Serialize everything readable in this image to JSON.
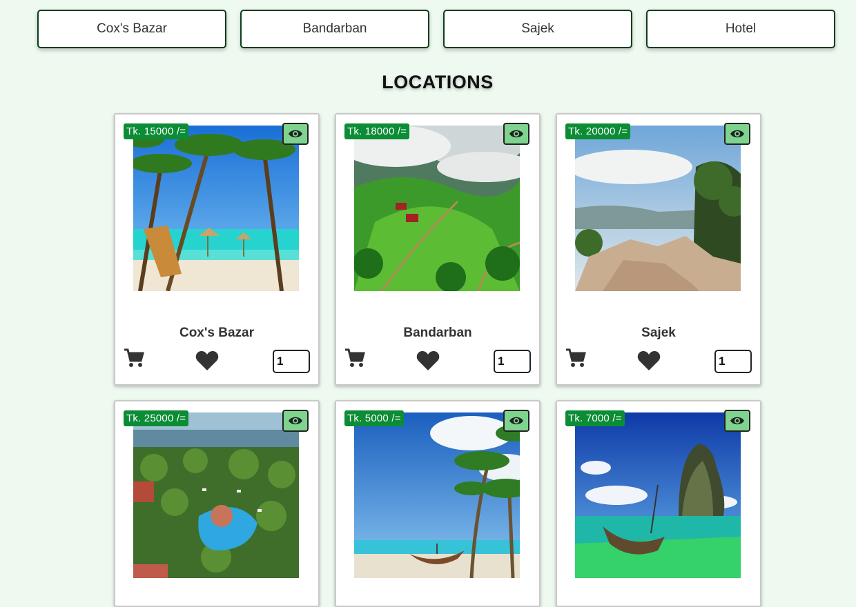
{
  "filters": [
    "Cox's Bazar",
    "Bandarban",
    "Sajek",
    "Hotel"
  ],
  "section_title": "LOCATIONS",
  "cards": [
    {
      "price": "Tk. 15000 /=",
      "name": "Cox's Bazar",
      "qty": "1",
      "image": "beach-palms"
    },
    {
      "price": "Tk. 18000 /=",
      "name": "Bandarban",
      "qty": "1",
      "image": "green-hills"
    },
    {
      "price": "Tk. 20000 /=",
      "name": "Sajek",
      "qty": "1",
      "image": "rocky-cliff"
    },
    {
      "price": "Tk. 25000 /=",
      "name": "",
      "qty": "",
      "image": "resort-pool"
    },
    {
      "price": "Tk. 5000 /=",
      "name": "",
      "qty": "",
      "image": "beach-boat"
    },
    {
      "price": "Tk. 7000 /=",
      "name": "",
      "qty": "",
      "image": "lagoon-boat"
    }
  ],
  "colors": {
    "background": "#eef9f0",
    "price_badge": "#0b8c35",
    "eye_button": "#7ed48f",
    "border": "#0f3d1a"
  }
}
